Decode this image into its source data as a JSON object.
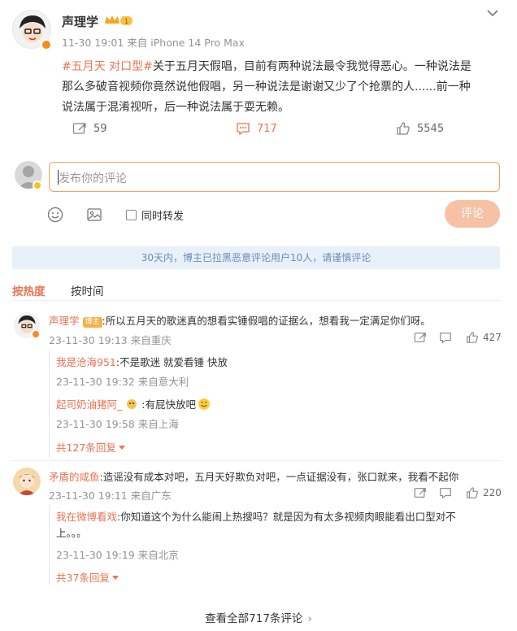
{
  "post": {
    "author": "声理学",
    "meta": "11-30 19:01 来自 iPhone 14 Pro Max",
    "tag1": "#五月天 对口型#",
    "text_line1": "关于五月天假唱，目前有两种说法最令我觉得恶心。一种说法是",
    "text_line2": "那么多破音视频你竟然说他假唱，另一种说法是谢谢又少了个抢票的人......前一种",
    "text_line3": "说法属于混淆视听，后一种说法属于耍无赖。",
    "repost_count": "59",
    "comment_count": "717",
    "like_count": "5545"
  },
  "composer": {
    "placeholder": "发布你的评论",
    "also_repost": "同时转发",
    "submit": "评论"
  },
  "notice": "30天内，博主已拉黑恶意评论用户10人，请谨慎评论",
  "sort_tabs": [
    "按热度",
    "按时间"
  ],
  "comments": [
    {
      "author": "声理学",
      "badge": "博主",
      "text": ":所以五月天的歌迷真的想看实锤假唱的证据么，想看我一定满足你们呀。",
      "meta": "23-11-30 19:13 来自重庆",
      "likes": "427",
      "replies": [
        {
          "author": "我是沧海951",
          "text": ":不是歌迷 就爱看锤 快放",
          "meta": "23-11-30 19:32 来自意大利"
        },
        {
          "author": "起司奶油猪阿_",
          "text": ":有屁快放吧",
          "meta": "23-11-30 19:58 来自上海"
        }
      ],
      "more": "共127条回复"
    },
    {
      "author": "矛盾的咸鱼",
      "text": ":造谣没有成本对吧，五月天好欺负对吧，一点证据没有，张口就来，我看不起你",
      "meta": "23-11-30 19:11 来自广东",
      "likes": "220",
      "replies": [
        {
          "author": "我在微博看戏",
          "text_line1": ":你知道这个为什么能闹上热搜吗？就是因为有太多视频肉眼能看出口型对不",
          "text_line2": "上。。。",
          "meta": "23-11-30 19:19 来自北京"
        }
      ],
      "more": "共37条回复"
    }
  ],
  "view_all": "查看全部717条评论"
}
